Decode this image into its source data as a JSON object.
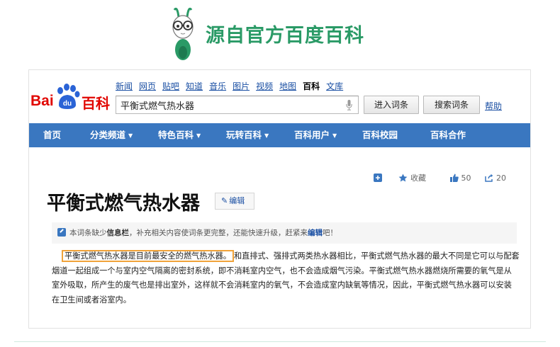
{
  "banner": {
    "title": "源自官方百度百科"
  },
  "logo": {
    "bai": "Bai",
    "du": "du",
    "baike": "百科"
  },
  "top_links": [
    {
      "label": "新闻",
      "active": false
    },
    {
      "label": "网页",
      "active": false
    },
    {
      "label": "贴吧",
      "active": false
    },
    {
      "label": "知道",
      "active": false
    },
    {
      "label": "音乐",
      "active": false
    },
    {
      "label": "图片",
      "active": false
    },
    {
      "label": "视频",
      "active": false
    },
    {
      "label": "地图",
      "active": false
    },
    {
      "label": "百科",
      "active": true
    },
    {
      "label": "文库",
      "active": false
    }
  ],
  "search": {
    "value": "平衡式燃气热水器"
  },
  "buttons": {
    "enter": "进入词条",
    "search": "搜索词条",
    "help": "帮助"
  },
  "navbar": [
    {
      "label": "首页",
      "dropdown": false
    },
    {
      "label": "分类频道",
      "dropdown": true
    },
    {
      "label": "特色百科",
      "dropdown": true
    },
    {
      "label": "玩转百科",
      "dropdown": true
    },
    {
      "label": "百科用户",
      "dropdown": true
    },
    {
      "label": "百科校园",
      "dropdown": false
    },
    {
      "label": "百科合作",
      "dropdown": false
    }
  ],
  "tools": {
    "collect": "收藏",
    "likes": "50",
    "shares": "20"
  },
  "article": {
    "title": "平衡式燃气热水器",
    "edit": "编辑",
    "notice_pre": "本词条缺少",
    "notice_bold": "信息栏",
    "notice_mid": "，补充相关内容使词条更完整，还能快速升级，赶紧来",
    "notice_link": "编辑",
    "notice_end": "吧！",
    "highlight": "平衡式燃气热水器是目前最安全的燃气热水器。",
    "body": "和直排式、强排式两类热水器相比，平衡式燃气热水器的最大不同是它可以与配套烟道一起组成一个与室内空气隔离的密封系统，即不消耗室内空气，也不会造成烟气污染。平衡式燃气热水器燃烧所需要的氧气是从室外吸取，所产生的废气也是排出室外，这样就不会消耗室内的氧气，不会造成室内缺氧等情况，因此，平衡式燃气热水器可以安装在卫生间或者浴室内。"
  },
  "colors": {
    "brand_green": "#2a9a66",
    "baidu_red": "#e10601",
    "baidu_blue": "#2a63d6",
    "nav_blue": "#3a77c0",
    "highlight_orange": "#f0a33a"
  }
}
